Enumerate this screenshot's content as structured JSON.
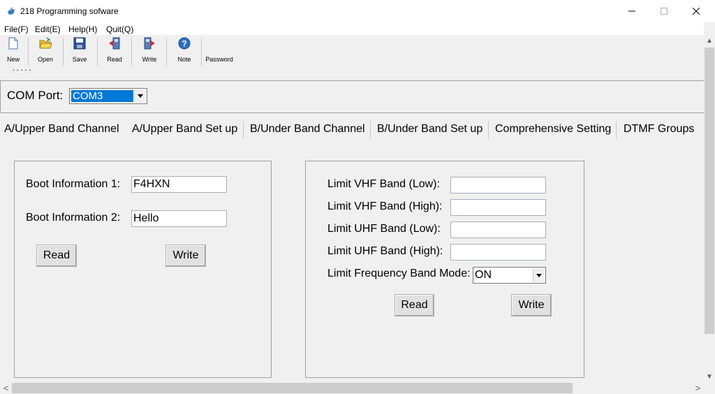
{
  "window": {
    "title": "218 Programming sofware",
    "icon": "walkie-talkie-icon",
    "controls": [
      "minimize-icon",
      "maximize-icon",
      "close-icon"
    ]
  },
  "menu": {
    "file": "File(F)",
    "edit": "Edit(E)",
    "help": "Help(H)",
    "quit": "Quit(Q)"
  },
  "toolbar": {
    "new": "New",
    "open": "Open",
    "save": "Save",
    "read": "Read",
    "write": "Write",
    "note": "Note",
    "password": "Password"
  },
  "com": {
    "label": "COM Port:",
    "value": "COM3"
  },
  "tabs": [
    "A/Upper Band Channel",
    "A/Upper Band Set up",
    "B/Under Band Channel",
    "B/Under Band Set up",
    "Comprehensive Setting",
    "DTMF Groups"
  ],
  "boot": {
    "label1": "Boot Information 1:",
    "value1": "F4HXN",
    "label2": "Boot Information 2:",
    "value2": "Hello",
    "read": "Read",
    "write": "Write"
  },
  "limits": {
    "vhf_low_label": "Limit VHF Band (Low):",
    "vhf_low_value": "",
    "vhf_high_label": "Limit VHF Band (High):",
    "vhf_high_value": "",
    "uhf_low_label": "Limit UHF Band (Low):",
    "uhf_low_value": "",
    "uhf_high_label": "Limit UHF Band (High):",
    "uhf_high_value": "",
    "mode_label": "Limit Frequency Band Mode:",
    "mode_value": "ON",
    "read": "Read",
    "write": "Write"
  },
  "scrollbars": {
    "up": "▲",
    "down": "▼",
    "left": "<",
    "right": ">"
  },
  "colors": {
    "selection": "#0078d7",
    "window_bg": "#f0f0f0"
  }
}
